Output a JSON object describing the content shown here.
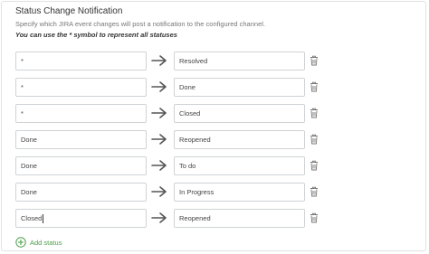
{
  "section": {
    "title": "Status Change Notification",
    "description": "Specify which JIRA event changes will post a notification to the configured channel.",
    "hint": "You can use the * symbol to represent all statuses"
  },
  "mappings": [
    {
      "from": "*",
      "to": "Resolved"
    },
    {
      "from": "*",
      "to": "Done"
    },
    {
      "from": "*",
      "to": "Closed"
    },
    {
      "from": "Done",
      "to": "Reopened"
    },
    {
      "from": "Done",
      "to": "To do"
    },
    {
      "from": "Done",
      "to": "In Progress"
    },
    {
      "from": "Closed",
      "to": "Reopened"
    }
  ],
  "add_status_label": "Add status",
  "icons": {
    "arrow": "arrow-right-icon",
    "delete": "trash-icon",
    "add": "plus-circle-icon"
  },
  "colors": {
    "accent_green": "#4a9e4a",
    "border": "#cfd3d6",
    "icon_gray": "#777777"
  }
}
